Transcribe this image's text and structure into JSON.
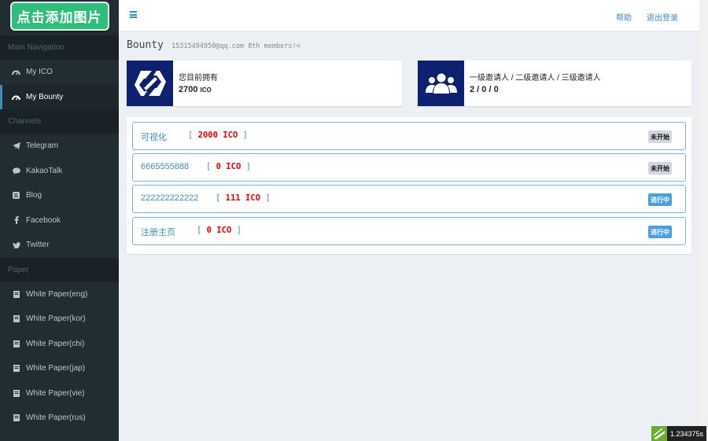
{
  "logo": {
    "label": "点击添加图片",
    "color": "#2ebd7c"
  },
  "sidebar": {
    "sections": [
      {
        "header": "Main Navigation",
        "items": [
          {
            "label": "My ICO",
            "icon": "dashboard-icon",
            "active": false
          },
          {
            "label": "My Bounty",
            "icon": "dashboard-icon",
            "active": true
          }
        ]
      },
      {
        "header": "Channels",
        "items": [
          {
            "label": "Telegram",
            "icon": "paper-plane-icon"
          },
          {
            "label": "KakaoTalk",
            "icon": "chat-bubble-icon"
          },
          {
            "label": "Blog",
            "icon": "blogger-icon"
          },
          {
            "label": "Facebook",
            "icon": "facebook-icon"
          },
          {
            "label": "Twitter",
            "icon": "twitter-icon"
          }
        ]
      },
      {
        "header": "Paper",
        "items": [
          {
            "label": "White Paper(eng)",
            "icon": "document-icon"
          },
          {
            "label": "White Paper(kor)",
            "icon": "document-icon"
          },
          {
            "label": "White Paper(chi)",
            "icon": "document-icon"
          },
          {
            "label": "White Paper(jap)",
            "icon": "document-icon"
          },
          {
            "label": "White Paper(vie)",
            "icon": "document-icon"
          },
          {
            "label": "White Paper(rus)",
            "icon": "document-icon"
          }
        ]
      }
    ]
  },
  "header": {
    "menu_icon": "hamburger-icon",
    "help": "帮助",
    "logout": "退出登录"
  },
  "page": {
    "title": "Bounty",
    "subtitle": "15315494950@qq.com 8th members!<"
  },
  "info_boxes": [
    {
      "icon": "hyperledger-logo-icon",
      "label": "您目前拥有",
      "value": "2700",
      "unit": "ICO"
    },
    {
      "icon": "users-group-icon",
      "label": "一级邀请人 / 二级邀请人 / 三级邀请人",
      "value": "2 / 0 / 0"
    }
  ],
  "tasks": [
    {
      "name": "可视化",
      "bracket_open": "[ ",
      "amount": "2000 ICO",
      "bracket_close": " ]",
      "status": "未开始",
      "state": "pending"
    },
    {
      "name": "6665555888",
      "bracket_open": "[ ",
      "amount": "0 ICO",
      "bracket_close": " ]",
      "status": "未开始",
      "state": "pending"
    },
    {
      "name": "222222222222",
      "bracket_open": "[ ",
      "amount": "111 ICO",
      "bracket_close": " ]",
      "status": "进行中",
      "state": "active"
    },
    {
      "name": "注册主页",
      "bracket_open": "[ ",
      "amount": "0 ICO",
      "bracket_close": " ]",
      "status": "进行中",
      "state": "active"
    }
  ],
  "widget": {
    "text": "1.234375s"
  },
  "colors": {
    "sidebar": "#222d32",
    "accent": "#3c8dbc",
    "icon_bg": "#0d2170",
    "amount": "#ee0000"
  }
}
